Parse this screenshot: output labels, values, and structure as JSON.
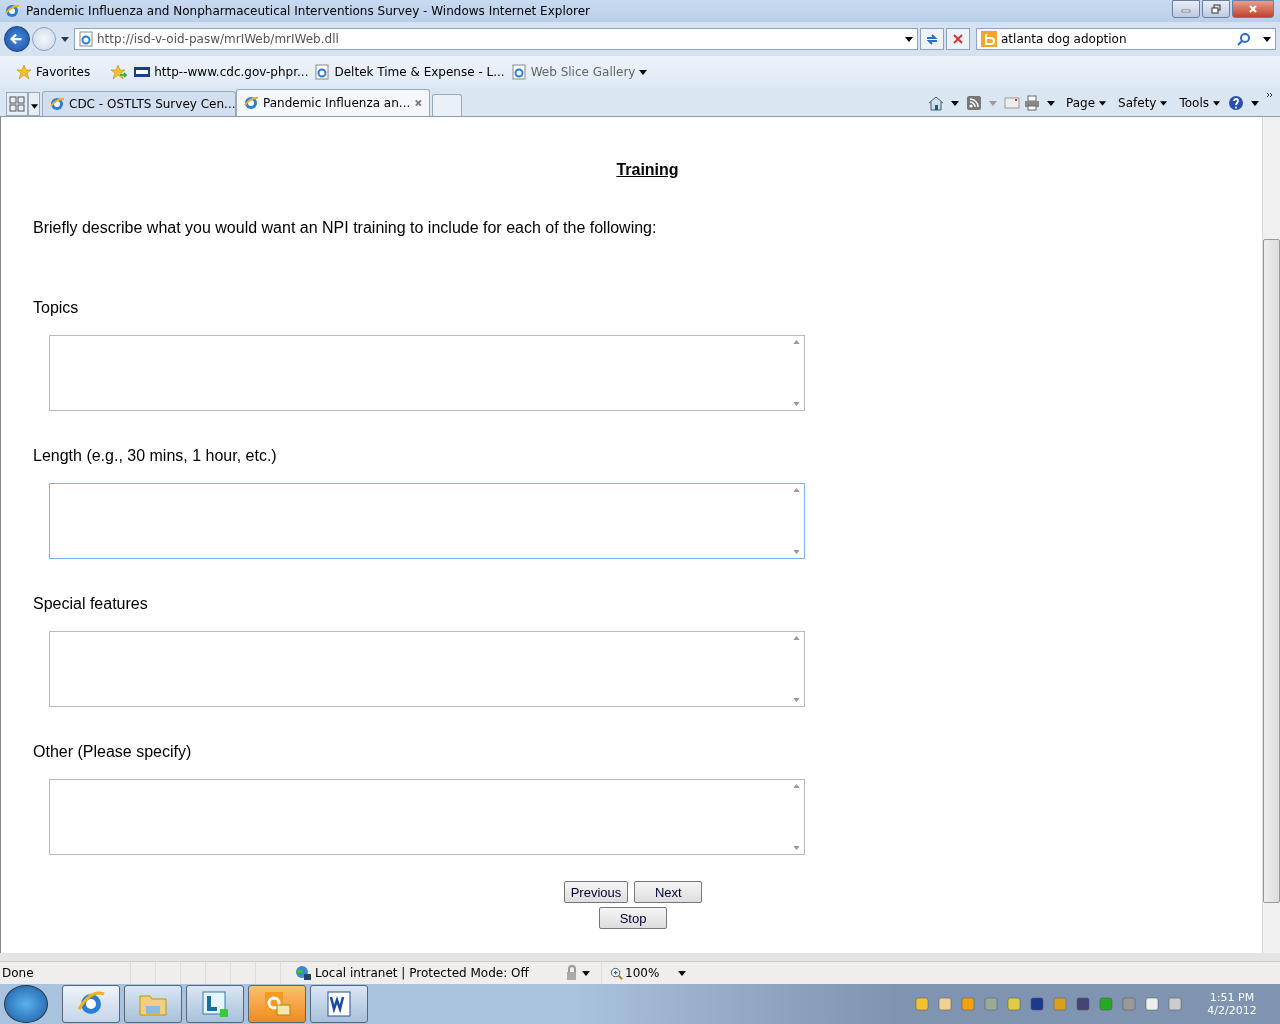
{
  "window": {
    "title": "Pandemic Influenza and Nonpharmaceutical Interventions Survey - Windows Internet Explorer"
  },
  "address": {
    "value": "http://isd-v-oid-pasw/mrIWeb/mrIWeb.dll"
  },
  "search": {
    "value": "atlanta dog adoption"
  },
  "favorites_bar": [
    {
      "label": "Favorites",
      "kind": "favorites"
    },
    {
      "label": "http--www.cdc.gov-phpr...",
      "kind": "cdc"
    },
    {
      "label": "Deltek Time & Expense - L...",
      "kind": "page"
    },
    {
      "label": "Web Slice Gallery",
      "kind": "gallery"
    }
  ],
  "tabs": [
    {
      "label": "CDC - OSTLTS Survey Cen...",
      "selected": false
    },
    {
      "label": "Pandemic Influenza an...",
      "selected": true
    }
  ],
  "commands": [
    "Page",
    "Safety",
    "Tools"
  ],
  "page": {
    "heading": "Training",
    "intro": "Briefly describe what you would want an NPI training to include for each of the following:",
    "fields": [
      {
        "label": "Topics",
        "focused": false
      },
      {
        "label": "Length (e.g., 30 mins, 1 hour, etc.)",
        "focused": true
      },
      {
        "label": "Special features",
        "focused": false
      },
      {
        "label": "Other (Please specify)",
        "focused": false
      }
    ],
    "buttons": [
      "Previous",
      "Next",
      "Stop"
    ]
  },
  "status_bar": {
    "status": "Done",
    "zone": "Local intranet | Protected Mode: Off",
    "zoom": "100%"
  },
  "clock": {
    "time": "1:51 PM",
    "date": "4/2/2012"
  }
}
